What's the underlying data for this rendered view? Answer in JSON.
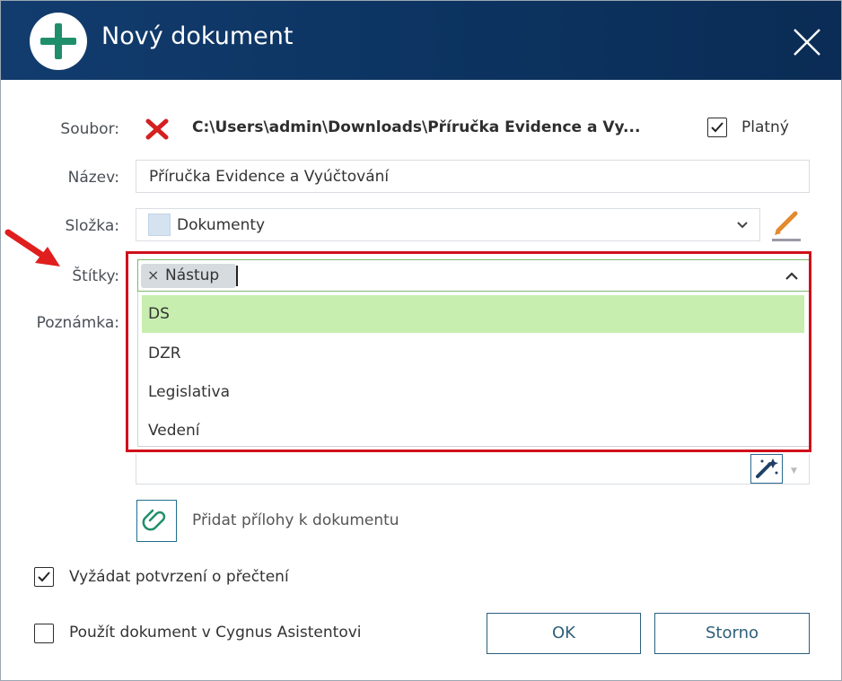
{
  "dialog": {
    "title": "Nový dokument",
    "title_icon": "plus-circle-icon",
    "close_icon": "close-icon"
  },
  "file": {
    "label": "Soubor:",
    "status_icon": "red-x-icon",
    "path": "C:\\Users\\admin\\Downloads\\Příručka Evidence a Vy...",
    "valid_label": "Platný",
    "valid_checked": true
  },
  "name": {
    "label": "Název:",
    "value": "Příručka Evidence a Vyúčtování"
  },
  "folder": {
    "label": "Složka:",
    "value": "Dokumenty",
    "edit_icon": "pencil-icon"
  },
  "tags": {
    "label": "Štítky:",
    "selected": [
      {
        "label": "Nástup",
        "remove": "×"
      }
    ],
    "options": [
      {
        "label": "DS",
        "highlighted": true
      },
      {
        "label": "DZR",
        "highlighted": false
      },
      {
        "label": "Legislativa",
        "highlighted": false
      },
      {
        "label": "Vedení",
        "highlighted": false
      }
    ]
  },
  "note": {
    "label": "Poznámka:",
    "wand_icon": "magic-wand-icon"
  },
  "attachments": {
    "button_icon": "paperclip-icon",
    "label": "Přidat přílohy k dokumentu"
  },
  "options": {
    "read_confirm_label": "Vyžádat potvrzení o přečtení",
    "read_confirm_checked": true,
    "assistant_label": "Použít dokument v Cygnus Asistentovi",
    "assistant_checked": false
  },
  "buttons": {
    "ok": "OK",
    "cancel": "Storno"
  },
  "colors": {
    "titlebar": "#0d3563",
    "highlight_border": "#d0101c",
    "option_highlight": "#c7eeaf",
    "accent": "#1f8f6b"
  }
}
